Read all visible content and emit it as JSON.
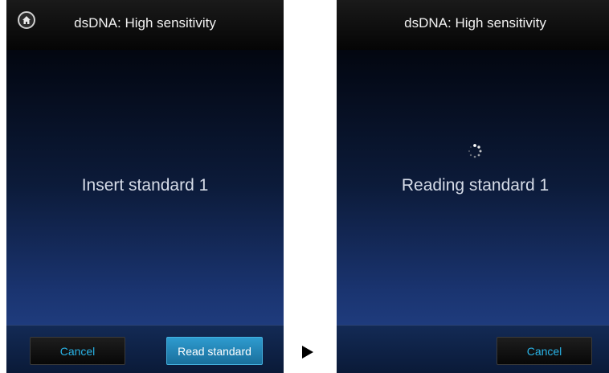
{
  "screens": {
    "left": {
      "title": "dsDNA: High sensitivity",
      "message": "Insert standard 1",
      "home_icon": "home-icon",
      "buttons": {
        "cancel": "Cancel",
        "read": "Read standard"
      }
    },
    "right": {
      "title": "dsDNA: High sensitivity",
      "message": "Reading standard 1",
      "status_icon": "spinner-icon",
      "buttons": {
        "cancel": "Cancel"
      }
    }
  },
  "transition_icon": "arrow-right-icon",
  "colors": {
    "accent": "#29b3e6",
    "primary_button": "#2189bb",
    "background_top": "#000000",
    "background_bottom": "#1f3c7e"
  }
}
